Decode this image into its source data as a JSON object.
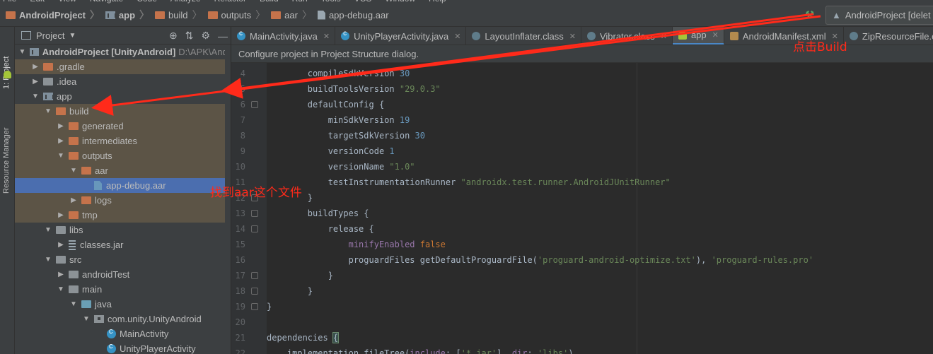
{
  "menu": [
    "File",
    "Edit",
    "View",
    "Navigate",
    "Code",
    "Analyze",
    "Refactor",
    "Build",
    "Run",
    "Tools",
    "VCS",
    "Window",
    "Help"
  ],
  "breadcrumb": [
    {
      "label": "AndroidProject",
      "icon": "folder-icon",
      "bold": true
    },
    {
      "label": "app",
      "icon": "module-icon",
      "bold": true
    },
    {
      "label": "build",
      "icon": "folder-icon"
    },
    {
      "label": "outputs",
      "icon": "folder-icon"
    },
    {
      "label": "aar",
      "icon": "folder-icon"
    },
    {
      "label": "app-debug.aar",
      "icon": "file-icon"
    }
  ],
  "run_config": {
    "label": "AndroidProject [delet"
  },
  "toolstrip": {
    "project_tab": "1: Project",
    "resource_tab": "Resource Manager"
  },
  "project_panel": {
    "title": "Project",
    "tree": [
      {
        "label": "AndroidProject [UnityAndroid]",
        "path": "D:\\APK\\Andr",
        "bold": true,
        "expanded": true,
        "icon": "module",
        "level": 0
      },
      {
        "label": ".gradle",
        "expanded": false,
        "icon": "folder",
        "level": 1,
        "highlight": true
      },
      {
        "label": ".idea",
        "expanded": false,
        "icon": "folder-grey",
        "level": 1
      },
      {
        "label": "app",
        "expanded": true,
        "icon": "module",
        "level": 1
      },
      {
        "label": "build",
        "expanded": true,
        "icon": "folder",
        "level": 2,
        "highlight": true
      },
      {
        "label": "generated",
        "expanded": false,
        "icon": "folder",
        "level": 3,
        "highlight": true
      },
      {
        "label": "intermediates",
        "expanded": false,
        "icon": "folder",
        "level": 3,
        "highlight": true
      },
      {
        "label": "outputs",
        "expanded": true,
        "icon": "folder",
        "level": 3,
        "highlight": true
      },
      {
        "label": "aar",
        "expanded": true,
        "icon": "folder",
        "level": 4,
        "highlight": true
      },
      {
        "label": "app-debug.aar",
        "expanded": null,
        "icon": "aar",
        "level": 5,
        "selected": true
      },
      {
        "label": "logs",
        "expanded": false,
        "icon": "folder",
        "level": 4,
        "highlight": true
      },
      {
        "label": "tmp",
        "expanded": false,
        "icon": "folder",
        "level": 3,
        "highlight": true
      },
      {
        "label": "libs",
        "expanded": true,
        "icon": "folder-grey",
        "level": 2
      },
      {
        "label": "classes.jar",
        "expanded": false,
        "icon": "jar",
        "level": 3
      },
      {
        "label": "src",
        "expanded": true,
        "icon": "folder-grey",
        "level": 2
      },
      {
        "label": "androidTest",
        "expanded": false,
        "icon": "folder-grey",
        "level": 3
      },
      {
        "label": "main",
        "expanded": true,
        "icon": "folder-grey",
        "level": 3
      },
      {
        "label": "java",
        "expanded": true,
        "icon": "folder-blue",
        "level": 4
      },
      {
        "label": "com.unity.UnityAndroid",
        "expanded": true,
        "icon": "package",
        "level": 5
      },
      {
        "label": "MainActivity",
        "expanded": null,
        "icon": "class",
        "level": 6
      },
      {
        "label": "UnityPlayerActivity",
        "expanded": null,
        "icon": "class",
        "level": 6
      }
    ]
  },
  "tabs": [
    {
      "label": "MainActivity.java",
      "icon": "c",
      "closable": true
    },
    {
      "label": "UnityPlayerActivity.java",
      "icon": "c",
      "closable": true
    },
    {
      "label": "LayoutInflater.class",
      "icon": "cf",
      "closable": true
    },
    {
      "label": "Vibrator.class",
      "icon": "cf",
      "closable": true
    },
    {
      "label": "app",
      "icon": "m",
      "closable": true,
      "active": true
    },
    {
      "label": "AndroidManifest.xml",
      "icon": "x2",
      "closable": true
    },
    {
      "label": "ZipResourceFile.cla",
      "icon": "cf",
      "closable": false
    }
  ],
  "banner": "Configure project in Project Structure dialog.",
  "code_lines": [
    {
      "num": "4",
      "fold": false,
      "tokens": [
        [
          "plain",
          "        compileSdkVersion "
        ],
        [
          "num",
          "30"
        ]
      ]
    },
    {
      "num": "5",
      "fold": false,
      "tokens": [
        [
          "plain",
          "        buildToolsVersion "
        ],
        [
          "str",
          "\"29.0.3\""
        ]
      ]
    },
    {
      "num": "6",
      "fold": true,
      "tokens": [
        [
          "plain",
          "        defaultConfig {"
        ]
      ]
    },
    {
      "num": "7",
      "fold": false,
      "tokens": [
        [
          "plain",
          "            minSdkVersion "
        ],
        [
          "num",
          "19"
        ]
      ]
    },
    {
      "num": "8",
      "fold": false,
      "tokens": [
        [
          "plain",
          "            targetSdkVersion "
        ],
        [
          "num",
          "30"
        ]
      ]
    },
    {
      "num": "9",
      "fold": false,
      "tokens": [
        [
          "plain",
          "            versionCode "
        ],
        [
          "num",
          "1"
        ]
      ]
    },
    {
      "num": "10",
      "fold": false,
      "tokens": [
        [
          "plain",
          "            versionName "
        ],
        [
          "str",
          "\"1.0\""
        ]
      ]
    },
    {
      "num": "11",
      "fold": false,
      "tokens": [
        [
          "plain",
          "            testInstrumentationRunner "
        ],
        [
          "str",
          "\"androidx.test.runner.AndroidJUnitRunner\""
        ]
      ]
    },
    {
      "num": "12",
      "fold": true,
      "tokens": [
        [
          "plain",
          "        }"
        ]
      ]
    },
    {
      "num": "13",
      "fold": true,
      "tokens": [
        [
          "plain",
          "        buildTypes {"
        ]
      ]
    },
    {
      "num": "14",
      "fold": true,
      "tokens": [
        [
          "plain",
          "            release {"
        ]
      ]
    },
    {
      "num": "15",
      "fold": false,
      "tokens": [
        [
          "plain",
          "                "
        ],
        [
          "prop",
          "minifyEnabled "
        ],
        [
          "kw",
          "false"
        ]
      ]
    },
    {
      "num": "16",
      "fold": false,
      "tokens": [
        [
          "plain",
          "                proguardFiles getDefaultProguardFile("
        ],
        [
          "str",
          "'proguard-android-optimize.txt'"
        ],
        [
          "plain",
          "), "
        ],
        [
          "str",
          "'proguard-rules.pro'"
        ]
      ]
    },
    {
      "num": "17",
      "fold": true,
      "tokens": [
        [
          "plain",
          "            }"
        ]
      ]
    },
    {
      "num": "18",
      "fold": true,
      "tokens": [
        [
          "plain",
          "        }"
        ]
      ]
    },
    {
      "num": "19",
      "fold": true,
      "tokens": [
        [
          "plain",
          "}"
        ]
      ]
    },
    {
      "num": "20",
      "fold": false,
      "tokens": [
        [
          "plain",
          ""
        ]
      ]
    },
    {
      "num": "21",
      "fold": false,
      "tokens": [
        [
          "plain",
          "dependencies "
        ],
        [
          "brace",
          "{"
        ]
      ]
    },
    {
      "num": "22",
      "fold": false,
      "tokens": [
        [
          "plain",
          "    implementation fileTree("
        ],
        [
          "prop",
          "include"
        ],
        [
          "plain",
          ": ["
        ],
        [
          "str",
          "'*.jar'"
        ],
        [
          "plain",
          "], "
        ],
        [
          "prop",
          "dir"
        ],
        [
          "plain",
          ": "
        ],
        [
          "str",
          "'libs'"
        ],
        [
          "plain",
          ")"
        ]
      ]
    }
  ],
  "annotations": {
    "build_note": "点击Build",
    "aar_note": "找到aar这个文件",
    "color": "#ff2a1a"
  },
  "colors": {
    "selection": "#4b6eaf",
    "excluded_highlight": "#5c5446",
    "folder": "#c5734b",
    "keyword": "#cc7832",
    "number": "#6897bb",
    "string": "#6a8759"
  }
}
